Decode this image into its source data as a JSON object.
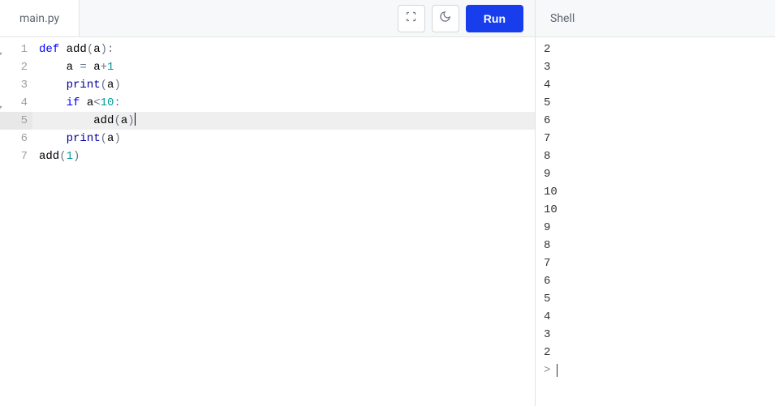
{
  "editor": {
    "tab_label": "main.py",
    "run_label": "Run",
    "lines": [
      {
        "n": "1",
        "fold": true,
        "indent": 0,
        "current": false,
        "tokens": [
          {
            "t": "def ",
            "c": "kw"
          },
          {
            "t": "add",
            "c": "fn"
          },
          {
            "t": "(",
            "c": "paren"
          },
          {
            "t": "a",
            "c": "var"
          },
          {
            "t": ")",
            "c": "paren"
          },
          {
            "t": ":",
            "c": "op"
          }
        ]
      },
      {
        "n": "2",
        "fold": false,
        "indent": 1,
        "current": false,
        "tokens": [
          {
            "t": "a",
            "c": "var"
          },
          {
            "t": " = ",
            "c": "op"
          },
          {
            "t": "a",
            "c": "var"
          },
          {
            "t": "+",
            "c": "op"
          },
          {
            "t": "1",
            "c": "num"
          }
        ]
      },
      {
        "n": "3",
        "fold": false,
        "indent": 1,
        "current": false,
        "tokens": [
          {
            "t": "print",
            "c": "builtin"
          },
          {
            "t": "(",
            "c": "paren"
          },
          {
            "t": "a",
            "c": "var"
          },
          {
            "t": ")",
            "c": "paren"
          }
        ]
      },
      {
        "n": "4",
        "fold": true,
        "indent": 1,
        "current": false,
        "tokens": [
          {
            "t": "if ",
            "c": "kw"
          },
          {
            "t": "a",
            "c": "var"
          },
          {
            "t": "<",
            "c": "op"
          },
          {
            "t": "10",
            "c": "num"
          },
          {
            "t": ":",
            "c": "op"
          }
        ]
      },
      {
        "n": "5",
        "fold": false,
        "indent": 2,
        "current": true,
        "cursor_after": true,
        "tokens": [
          {
            "t": "add",
            "c": "fn"
          },
          {
            "t": "(",
            "c": "paren"
          },
          {
            "t": "a",
            "c": "var"
          },
          {
            "t": ")",
            "c": "paren"
          }
        ]
      },
      {
        "n": "6",
        "fold": false,
        "indent": 1,
        "current": false,
        "tokens": [
          {
            "t": "print",
            "c": "builtin"
          },
          {
            "t": "(",
            "c": "paren"
          },
          {
            "t": "a",
            "c": "var"
          },
          {
            "t": ")",
            "c": "paren"
          }
        ]
      },
      {
        "n": "7",
        "fold": false,
        "indent": 0,
        "current": false,
        "tokens": [
          {
            "t": "add",
            "c": "fn"
          },
          {
            "t": "(",
            "c": "paren"
          },
          {
            "t": "1",
            "c": "num"
          },
          {
            "t": ")",
            "c": "paren"
          }
        ]
      }
    ]
  },
  "shell": {
    "title": "Shell",
    "output": [
      "2",
      "3",
      "4",
      "5",
      "6",
      "7",
      "8",
      "9",
      "10",
      "10",
      "9",
      "8",
      "7",
      "6",
      "5",
      "4",
      "3",
      "2"
    ],
    "prompt": ">"
  }
}
